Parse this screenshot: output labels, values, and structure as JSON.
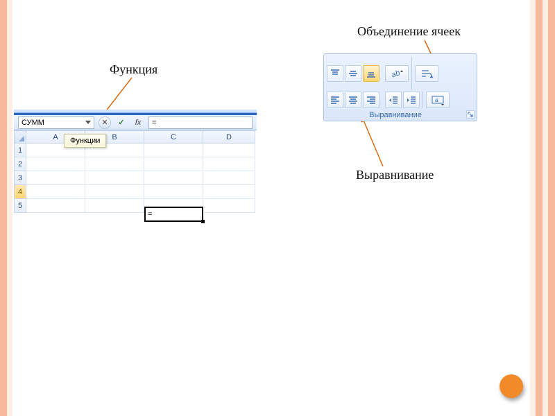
{
  "annotations": {
    "function": "Функция",
    "merge_cells": "Объединение ячеек",
    "alignment": "Выравнивание"
  },
  "excel": {
    "namebox_value": "СУММ",
    "formula_value": "=",
    "tooltip": "Функции",
    "columns": [
      "A",
      "B",
      "C",
      "D"
    ],
    "rows": [
      "1",
      "2",
      "3",
      "4",
      "5"
    ],
    "active_row": "4",
    "active_cell_value": "="
  },
  "ribbon": {
    "group_title": "Выравнивание",
    "buttons_row1": [
      "align-top",
      "align-middle",
      "align-bottom",
      "orientation",
      "wrap-text"
    ],
    "buttons_row2": [
      "align-left",
      "align-center",
      "align-right",
      "decrease-indent",
      "increase-indent",
      "merge-center"
    ]
  },
  "colors": {
    "accent": "#f28a2a",
    "arrow": "#d86a13",
    "ribbon_title": "#3b6db6"
  }
}
